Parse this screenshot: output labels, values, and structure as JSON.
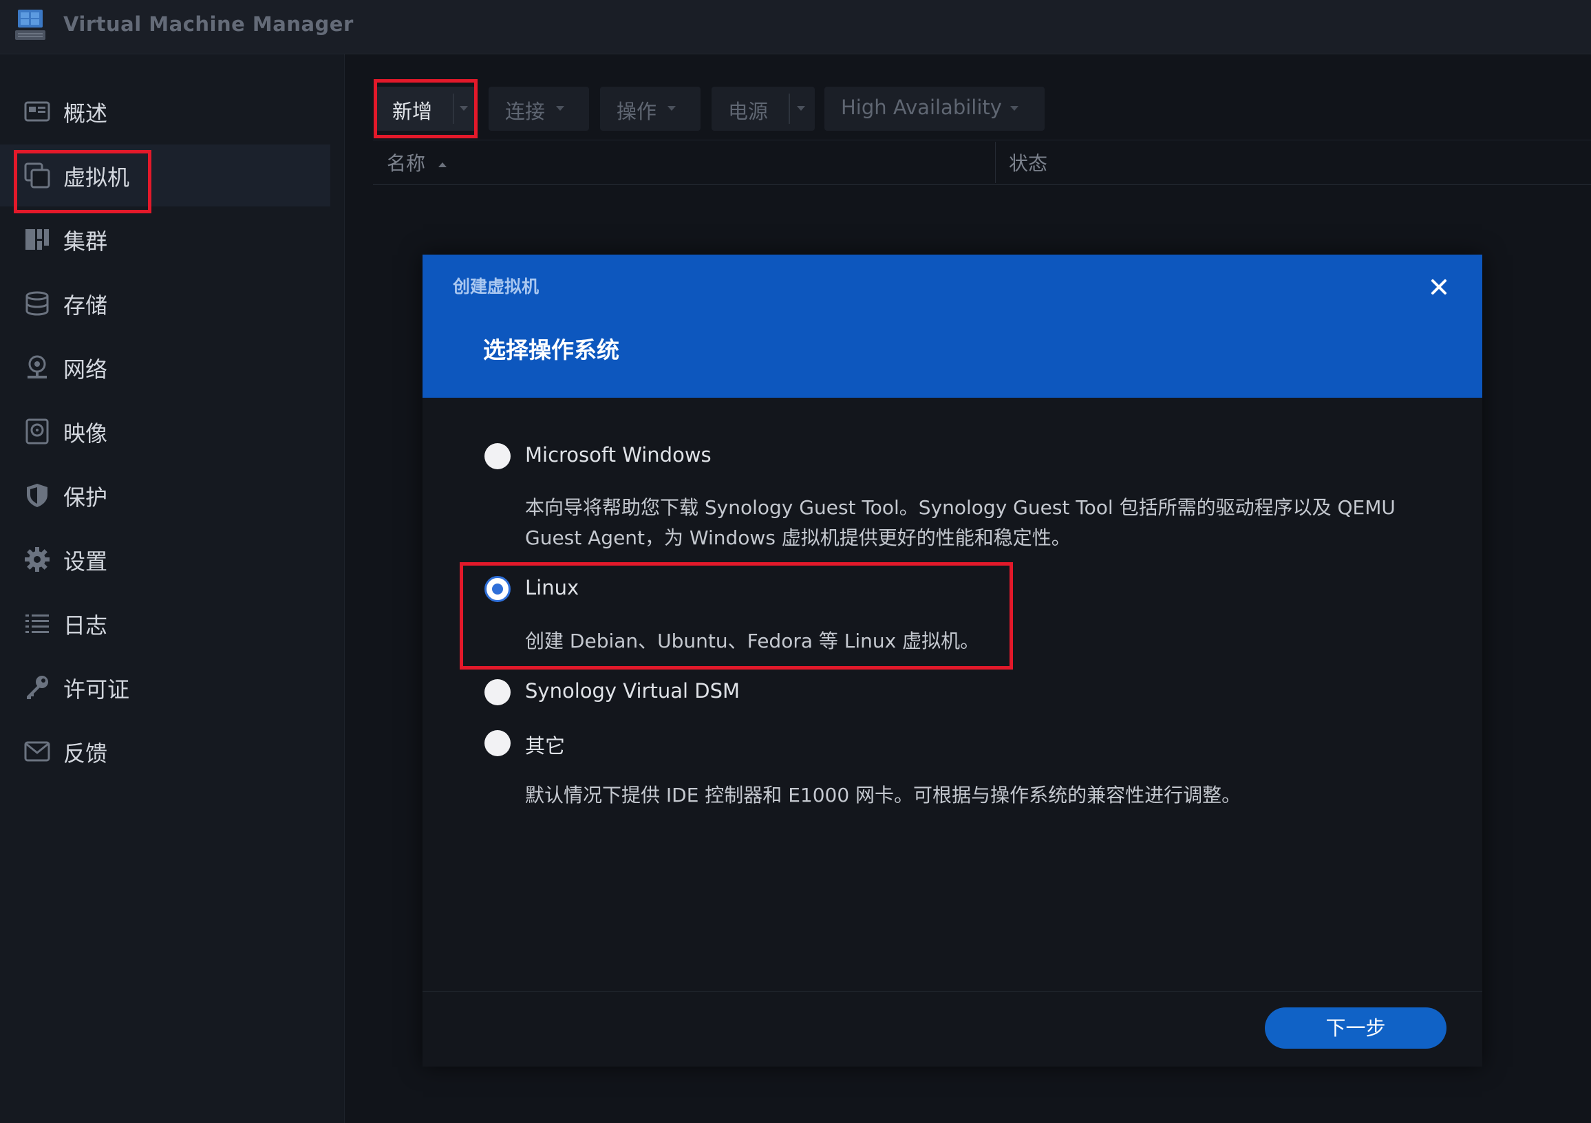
{
  "app": {
    "title": "Virtual Machine Manager"
  },
  "sidebar": {
    "items": [
      {
        "label": "概述",
        "icon": "overview-icon"
      },
      {
        "label": "虚拟机",
        "icon": "virtual-machine-icon",
        "active": true
      },
      {
        "label": "集群",
        "icon": "cluster-icon"
      },
      {
        "label": "存储",
        "icon": "storage-icon"
      },
      {
        "label": "网络",
        "icon": "network-icon"
      },
      {
        "label": "映像",
        "icon": "image-icon"
      },
      {
        "label": "保护",
        "icon": "shield-icon"
      },
      {
        "label": "设置",
        "icon": "gear-icon"
      },
      {
        "label": "日志",
        "icon": "log-list-icon"
      },
      {
        "label": "许可证",
        "icon": "key-icon"
      },
      {
        "label": "反馈",
        "icon": "mail-icon"
      }
    ]
  },
  "toolbar": {
    "create": "新增",
    "connect": "连接",
    "action": "操作",
    "power": "电源",
    "high_availability": "High Availability"
  },
  "table": {
    "columns": [
      "名称",
      "状态"
    ]
  },
  "dialog": {
    "small_title": "创建虚拟机",
    "title": "选择操作系统",
    "options": [
      {
        "label": "Microsoft Windows",
        "description": "本向导将帮助您下载 Synology Guest Tool。Synology Guest Tool 包括所需的驱动程序以及 QEMU Guest Agent，为 Windows 虚拟机提供更好的性能和稳定性。",
        "checked": false
      },
      {
        "label": "Linux",
        "description": "创建 Debian、Ubuntu、Fedora 等 Linux 虚拟机。",
        "checked": true
      },
      {
        "label": "Synology Virtual DSM",
        "description": "",
        "checked": false
      },
      {
        "label": "其它",
        "description": "默认情况下提供 IDE 控制器和 E1000 网卡。可根据与操作系统的兼容性进行调整。",
        "checked": false
      }
    ],
    "next_button": "下一步"
  },
  "colors": {
    "accent": "#0d57be",
    "highlight": "#e3192a",
    "background": "#11141a"
  }
}
